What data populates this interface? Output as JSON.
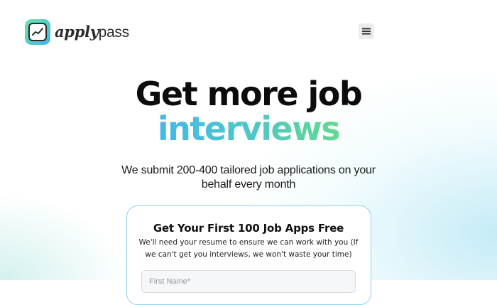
{
  "header": {
    "logo": {
      "text_apply": "apply",
      "text_pass": "pass",
      "icon": "chart-trend-icon"
    },
    "menu": {
      "icon": "hamburger-menu-icon"
    }
  },
  "hero": {
    "headline_line1": "Get more job",
    "headline_line2": "interviews",
    "subtitle": "We submit 200-400 tailored job applications on your behalf every month",
    "gradient_colors": [
      "#45b8ea",
      "#63d98e"
    ]
  },
  "form": {
    "title": "Get Your First 100 Job Apps Free",
    "description": "We'll need your resume to ensure we can work with you (If we can't get you interviews, we won't waste your time)",
    "first_name_placeholder": "First Name*",
    "accent_border": "#8fd3ea"
  }
}
